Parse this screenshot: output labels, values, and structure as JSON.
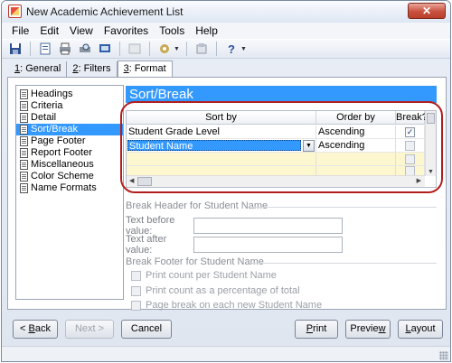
{
  "window": {
    "title": "New Academic Achievement List",
    "close_glyph": "✕"
  },
  "menu": [
    "File",
    "Edit",
    "View",
    "Favorites",
    "Tools",
    "Help"
  ],
  "toolbar": {
    "icons": [
      "save-icon",
      "new-icon",
      "print-icon",
      "print-preview-icon",
      "export-icon",
      "image-icon",
      "filter-icon",
      "report-icon",
      "help-icon"
    ],
    "help_glyph": "?"
  },
  "tabs": [
    {
      "key": "1",
      "rest": ": General"
    },
    {
      "key": "2",
      "rest": ": Filters"
    },
    {
      "key": "3",
      "rest": ": Format"
    }
  ],
  "nav": {
    "items": [
      "Headings",
      "Criteria",
      "Detail",
      "Sort/Break",
      "Page Footer",
      "Report Footer",
      "Miscellaneous",
      "Color Scheme",
      "Name Formats"
    ],
    "selected_index": 3
  },
  "section": {
    "title": "Sort/Break"
  },
  "grid": {
    "headers": {
      "sort_by": "Sort by",
      "order_by": "Order by",
      "break": "Break?"
    },
    "rows": [
      {
        "sort_by": "Student Grade Level",
        "order_by": "Ascending",
        "break": true
      },
      {
        "sort_by": "Student Name",
        "order_by": "Ascending",
        "break": false
      },
      {
        "sort_by": "",
        "order_by": "",
        "break": false
      },
      {
        "sort_by": "",
        "order_by": "",
        "break": false
      }
    ]
  },
  "break_header": {
    "title": "Break Header for Student Name",
    "before_label": "Text before value:",
    "before_value": "",
    "after_label": "Text after value:",
    "after_value": ""
  },
  "break_footer": {
    "title": "Break Footer for Student Name",
    "options": [
      "Print count per Student Name",
      "Print count as a percentage of total",
      "Page break on each new Student Name"
    ]
  },
  "buttons": {
    "back": {
      "key": "B",
      "pre": "< ",
      "rest": "ack"
    },
    "next": "Next >",
    "cancel": "Cancel",
    "print": {
      "key": "P",
      "rest": "rint"
    },
    "preview": {
      "pre": "Previe",
      "key": "w"
    },
    "layout": {
      "key": "L",
      "rest": "ayout"
    }
  }
}
